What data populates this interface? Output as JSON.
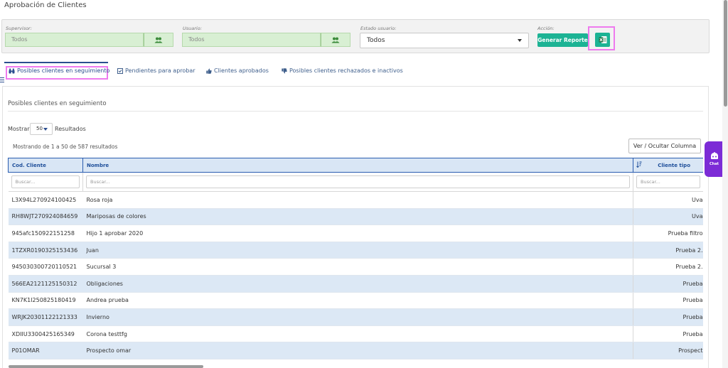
{
  "page": {
    "title": "Aprobación de Clientes"
  },
  "filters": {
    "supervisor": {
      "label": "Supervisor:",
      "value": "Todos"
    },
    "usuario": {
      "label": "Usuario:",
      "value": "Todos"
    },
    "estado": {
      "label": "Estado usuario:",
      "value": "Todos"
    },
    "accion": {
      "label": "Acción:",
      "generate_label": "Generar Reporte"
    }
  },
  "tabs": [
    {
      "label": "Posibles clientes en seguimiento",
      "icon": "binoculars-icon",
      "active": true
    },
    {
      "label": "Pendientes para aprobar",
      "icon": "check-square-icon"
    },
    {
      "label": "Clientes aprobados",
      "icon": "thumbs-up-icon"
    },
    {
      "label": "Posibles clientes rechazados e inactivos",
      "icon": "thumbs-down-icon"
    }
  ],
  "section": {
    "title": "Posibles clientes en seguimiento"
  },
  "pagination": {
    "show_label": "Mostrar",
    "page_size": "50",
    "results_label": "Resultados",
    "showing_text": "Mostrando de 1 a 50 de 587 resultados"
  },
  "toggle_columns_label": "Ver / Ocultar Columna",
  "table": {
    "columns": [
      "Cod. Cliente",
      "Nombre",
      "Cliente tipo"
    ],
    "search_placeholder": "Buscar...",
    "rows": [
      {
        "cod": "L3X94L270924100425",
        "nombre": "Rosa roja",
        "tipo": "Uva"
      },
      {
        "cod": "RH8WJT270924084659",
        "nombre": "Mariposas de colores",
        "tipo": "Uva"
      },
      {
        "cod": "945afc150922151258",
        "nombre": "Hijo 1 aprobar 2020",
        "tipo": "Prueba filtro"
      },
      {
        "cod": "1TZXR0190325153436",
        "nombre": "Juan",
        "tipo": "Prueba 2."
      },
      {
        "cod": "945030300720110521",
        "nombre": "Sucursal 3",
        "tipo": "Prueba 2."
      },
      {
        "cod": "566EA2121125150312",
        "nombre": "Obligaciones",
        "tipo": "Prueba"
      },
      {
        "cod": "KN7K1I250825180419",
        "nombre": "Andrea prueba",
        "tipo": "Prueba"
      },
      {
        "cod": "WRJK20301122121333",
        "nombre": "Invierno",
        "tipo": "Prueba"
      },
      {
        "cod": "XDIIU3300425165349",
        "nombre": "Corona testtfg",
        "tipo": "Prueba"
      },
      {
        "cod": "P01OMAR",
        "nombre": "Prospecto omar",
        "tipo": "Prospect"
      }
    ]
  },
  "chat": {
    "label": "Chat",
    "icon": "chat-bot-icon"
  },
  "colors": {
    "accent_green": "#1cb394",
    "header_blue": "#2a5db0",
    "row_alt": "#dce8f5",
    "chat_purple": "#7c2bd6"
  }
}
